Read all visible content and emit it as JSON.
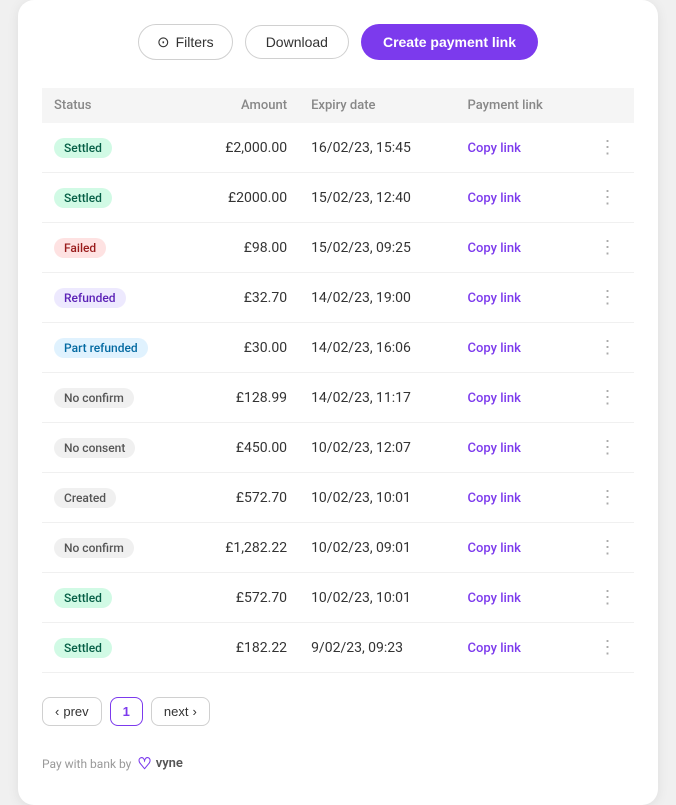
{
  "toolbar": {
    "filters_label": "Filters",
    "download_label": "Download",
    "create_label": "Create payment link"
  },
  "table": {
    "headers": [
      "Status",
      "Amount",
      "Expiry date",
      "Payment link",
      ""
    ],
    "rows": [
      {
        "status": "Settled",
        "badge_class": "badge-settled",
        "amount": "£2,000.00",
        "expiry": "16/02/23, 15:45",
        "link": "Copy link"
      },
      {
        "status": "Settled",
        "badge_class": "badge-settled",
        "amount": "£2000.00",
        "expiry": "15/02/23, 12:40",
        "link": "Copy link"
      },
      {
        "status": "Failed",
        "badge_class": "badge-failed",
        "amount": "£98.00",
        "expiry": "15/02/23, 09:25",
        "link": "Copy link"
      },
      {
        "status": "Refunded",
        "badge_class": "badge-refunded",
        "amount": "£32.70",
        "expiry": "14/02/23, 19:00",
        "link": "Copy link"
      },
      {
        "status": "Part refunded",
        "badge_class": "badge-part-refunded",
        "amount": "£30.00",
        "expiry": "14/02/23, 16:06",
        "link": "Copy link"
      },
      {
        "status": "No confirm",
        "badge_class": "badge-no-confirm",
        "amount": "£128.99",
        "expiry": "14/02/23, 11:17",
        "link": "Copy link"
      },
      {
        "status": "No consent",
        "badge_class": "badge-no-consent",
        "amount": "£450.00",
        "expiry": "10/02/23, 12:07",
        "link": "Copy link"
      },
      {
        "status": "Created",
        "badge_class": "badge-created",
        "amount": "£572.70",
        "expiry": "10/02/23, 10:01",
        "link": "Copy link"
      },
      {
        "status": "No confirm",
        "badge_class": "badge-no-confirm",
        "amount": "£1,282.22",
        "expiry": "10/02/23, 09:01",
        "link": "Copy link"
      },
      {
        "status": "Settled",
        "badge_class": "badge-settled",
        "amount": "£572.70",
        "expiry": "10/02/23, 10:01",
        "link": "Copy link"
      },
      {
        "status": "Settled",
        "badge_class": "badge-settled",
        "amount": "£182.22",
        "expiry": "9/02/23, 09:23",
        "link": "Copy link"
      }
    ]
  },
  "pagination": {
    "prev_label": "prev",
    "page": "1",
    "next_label": "next"
  },
  "footer": {
    "text": "Pay with bank by",
    "brand": "vyne"
  }
}
